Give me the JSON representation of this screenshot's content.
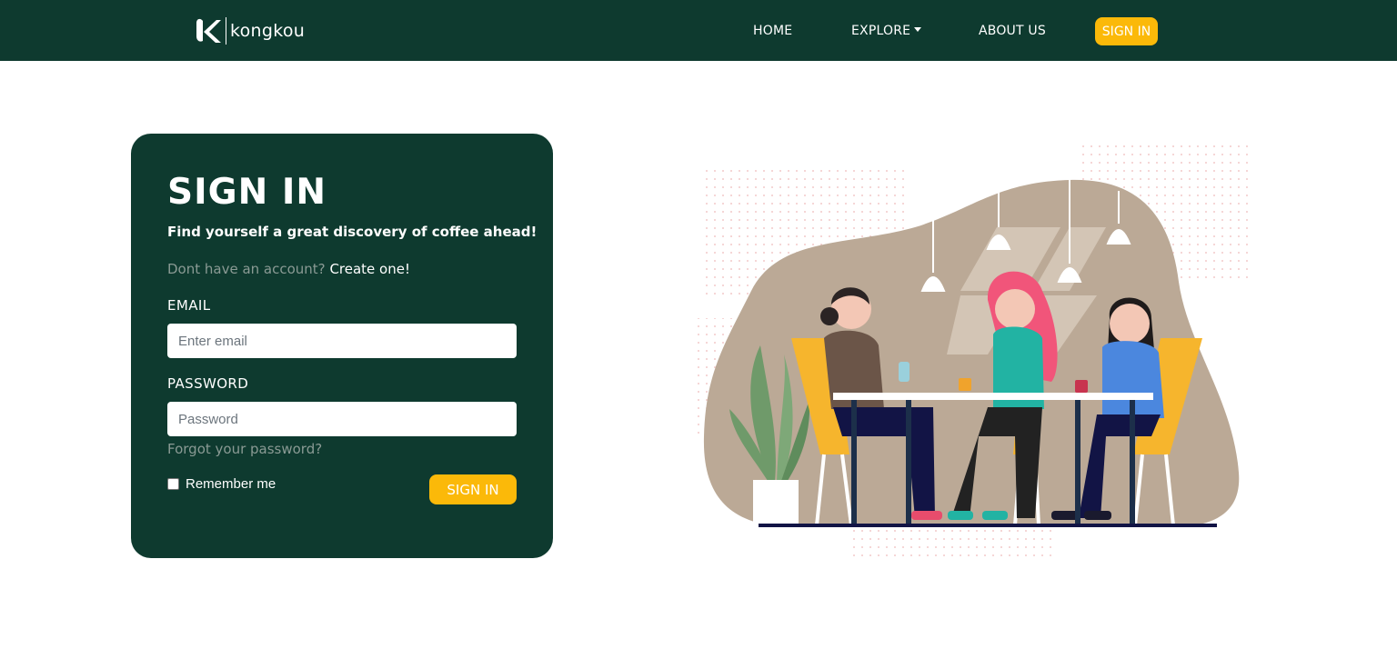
{
  "brand": {
    "name": "kongkou",
    "logo_icon": "k-logo-icon"
  },
  "nav": {
    "home": "HOME",
    "explore": "EXPLORE",
    "about": "ABOUT US",
    "signin": "SIGN IN"
  },
  "form": {
    "title": "SIGN IN",
    "subtitle": "Find yourself a great discovery of coffee ahead!",
    "account_prompt": "Dont have an account?",
    "create_link": "Create one!",
    "email_label": "EMAIL",
    "email_placeholder": "Enter email",
    "email_value": "",
    "password_label": "PASSWORD",
    "password_placeholder": "Password",
    "password_value": "",
    "forgot": "Forgot your password?",
    "remember": "Remember me",
    "remember_checked": false,
    "submit": "SIGN IN"
  },
  "colors": {
    "primary": "#0e3a2f",
    "accent": "#fbb909",
    "muted_text": "#8a9a94",
    "white": "#ffffff"
  }
}
